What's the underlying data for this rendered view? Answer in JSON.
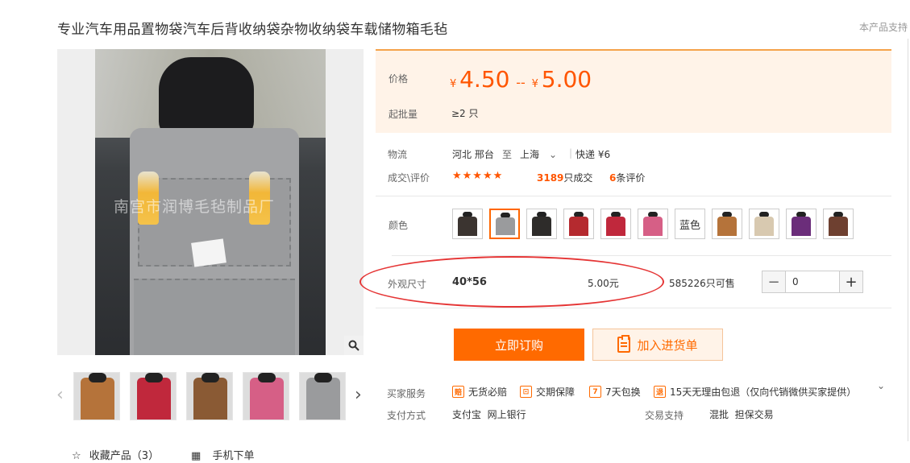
{
  "product": {
    "title": "专业汽车用品置物袋汽车后背收纳袋杂物收纳袋车载储物箱毛毡",
    "support_link": "本产品支持"
  },
  "gallery": {
    "watermark": "南宫市润博毛毡制品厂",
    "zoom_icon": "magnifier-icon",
    "thumbnails": [
      {
        "color": "#b5733a"
      },
      {
        "color": "#c0283c"
      },
      {
        "color": "#8a5a34"
      },
      {
        "color": "#d65f86"
      },
      {
        "color": "#9a9b9d"
      }
    ],
    "prev_icon": "‹",
    "next_icon": "›"
  },
  "actions": {
    "favorite_label": "收藏产品（3）",
    "mobile_label": "手机下单"
  },
  "price": {
    "label": "价格",
    "currency": "¥",
    "low": "4.50",
    "separator": "--",
    "high": "5.00",
    "moq_label": "起批量",
    "moq_value": "≥2 只"
  },
  "logistics": {
    "label": "物流",
    "from": "河北 邢台",
    "to_word": "至",
    "to": "上海",
    "express": "快递 ¥6"
  },
  "deals": {
    "label": "成交\\评价",
    "stars": "★★★★★",
    "deal_count": "3189",
    "deal_suffix": "只成交",
    "review_count": "6",
    "review_suffix": "条评价"
  },
  "colors": {
    "label": "颜色",
    "options": [
      {
        "type": "image",
        "color": "#3b3430"
      },
      {
        "type": "image",
        "color": "#9a9b9d",
        "selected": true
      },
      {
        "type": "image",
        "color": "#2e2c2a"
      },
      {
        "type": "image",
        "color": "#b52a2f"
      },
      {
        "type": "image",
        "color": "#c0283c"
      },
      {
        "type": "image",
        "color": "#d65f86"
      },
      {
        "type": "text",
        "text": "蓝色"
      },
      {
        "type": "image",
        "color": "#b5733a"
      },
      {
        "type": "image",
        "color": "#d8c9b0"
      },
      {
        "type": "image",
        "color": "#6b2d7a"
      },
      {
        "type": "image",
        "color": "#6e4030"
      }
    ]
  },
  "size": {
    "label": "外观尺寸",
    "value": "40*56",
    "price": "5.00元",
    "stock": "585226只可售"
  },
  "quantity": {
    "minus": "−",
    "value": "0",
    "plus": "+"
  },
  "buttons": {
    "buy": "立即订购",
    "cart": "加入进货单"
  },
  "services": {
    "label": "买家服务",
    "items": [
      {
        "icon": "赔",
        "text": "无货必赔"
      },
      {
        "icon": "⊡",
        "text": "交期保障"
      },
      {
        "icon": "7",
        "text": "7天包换"
      },
      {
        "icon": "退",
        "text": "15天无理由包退（仅向代销微供买家提供）"
      }
    ],
    "expand_icon": "chevron-down-icon"
  },
  "payment": {
    "label": "支付方式",
    "methods": "支付宝  网上银行",
    "trade_label": "交易支持",
    "trade_value": "混批  担保交易"
  },
  "accent_color": "#ff6a00"
}
